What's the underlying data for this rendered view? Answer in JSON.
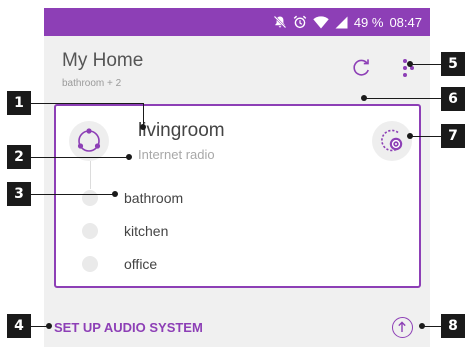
{
  "status_bar": {
    "battery": "49 %",
    "time": "08:47"
  },
  "app_bar": {
    "title": "My Home",
    "subtitle": "bathroom + 2",
    "refresh_icon": "refresh-icon",
    "more_icon": "more-vert-icon"
  },
  "group_card": {
    "room_name": "livingroom",
    "source": "Internet radio",
    "group_icon": "group-icon",
    "source_icon": "source-select-icon",
    "rooms": [
      {
        "label": "bathroom"
      },
      {
        "label": "kitchen"
      },
      {
        "label": "office"
      }
    ]
  },
  "footer": {
    "setup_label": "SET UP AUDIO SYSTEM",
    "up_icon": "arrow-up-icon"
  },
  "callouts": [
    "1",
    "2",
    "3",
    "4",
    "5",
    "6",
    "7",
    "8"
  ],
  "colors": {
    "accent": "#8d3fb6",
    "background": "#f0f0f0",
    "badge": "#1a1a1a"
  }
}
